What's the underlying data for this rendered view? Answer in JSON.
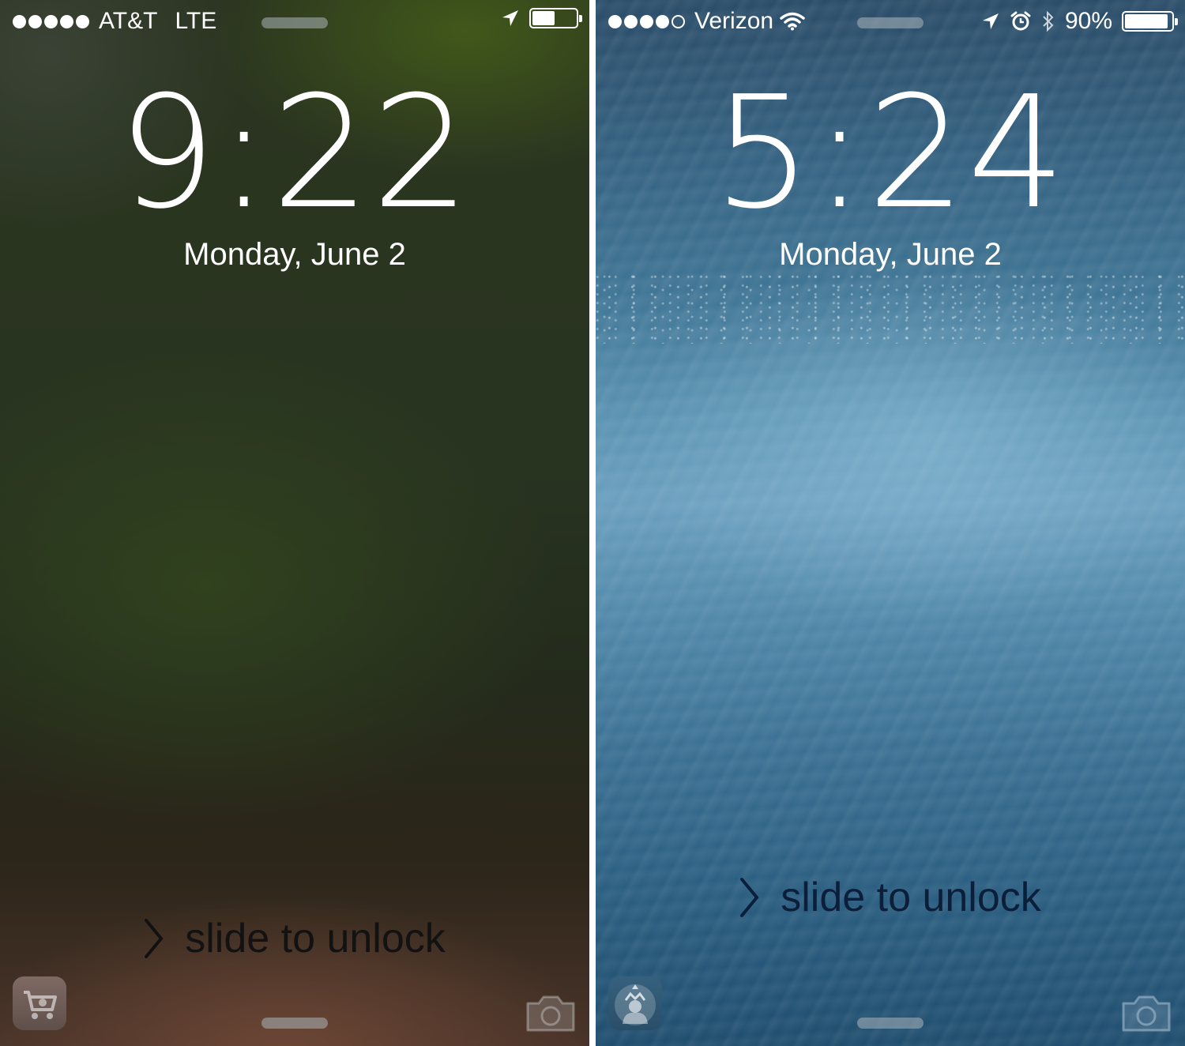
{
  "left": {
    "status_bar": {
      "signal_dots_filled": 5,
      "signal_dots_total": 5,
      "carrier": "AT&T",
      "network": "LTE",
      "icons": [
        "location-arrow-icon"
      ],
      "battery_level": 0.55
    },
    "time": "9:22",
    "date": "Monday, June 2",
    "slide_text": "slide to unlock",
    "app_suggestion": "apple-store-app-icon"
  },
  "right": {
    "status_bar": {
      "signal_dots_filled": 4,
      "signal_dots_total": 5,
      "carrier": "Verizon",
      "icons": [
        "wifi-icon",
        "location-arrow-icon",
        "alarm-clock-icon",
        "bluetooth-icon"
      ],
      "battery_percent": "90%",
      "battery_level": 0.9
    },
    "time": "5:24",
    "date": "Monday, June 2",
    "slide_text": "slide to unlock",
    "app_suggestion": "starbucks-app-icon"
  },
  "colors": {
    "left_background": "#2a3320",
    "right_background": "#3f7595",
    "text": "#ffffff"
  }
}
